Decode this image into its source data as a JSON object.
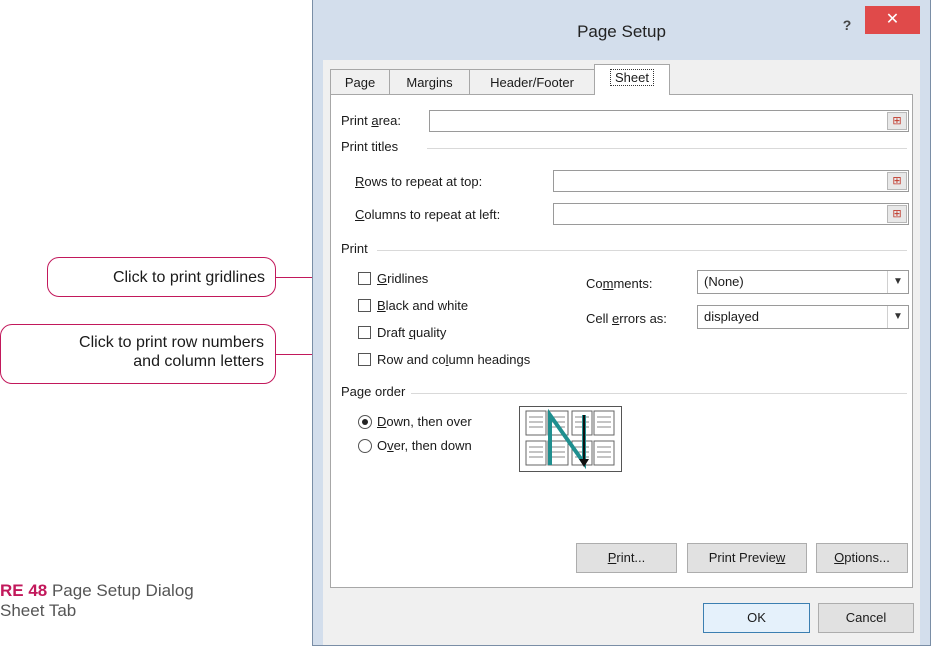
{
  "annotations": {
    "gridlines": "Click to print gridlines",
    "headings_line1": "Click to print row numbers",
    "headings_line2": "and column letters"
  },
  "caption": {
    "figure": "RE 48",
    "text": " Page Setup Dialog",
    "line2": " Sheet Tab"
  },
  "dialog": {
    "title": "Page Setup",
    "help": "?",
    "close": "✕",
    "tabs": [
      "Page",
      "Margins",
      "Header/Footer",
      "Sheet"
    ],
    "active_tab": "Sheet",
    "print_area": {
      "pre": "Print ",
      "key": "a",
      "post": "rea:",
      "value": ""
    },
    "print_titles": {
      "heading": "Print titles",
      "rows": {
        "key": "R",
        "post": "ows to repeat at top:",
        "value": ""
      },
      "columns": {
        "key": "C",
        "post": "olumns to repeat at left:",
        "value": ""
      }
    },
    "print": {
      "heading": "Print",
      "gridlines": {
        "key": "G",
        "post": "ridlines",
        "checked": false
      },
      "black_white": {
        "key": "B",
        "post": "lack and white",
        "checked": false
      },
      "draft": {
        "pre": "Draft ",
        "key": "q",
        "post": "uality",
        "checked": false
      },
      "headings": {
        "pre": "Row and co",
        "key": "l",
        "post": "umn headings",
        "checked": false
      },
      "comments": {
        "pre": "Co",
        "key": "m",
        "post": "ments:",
        "value": "(None)"
      },
      "cell_errors": {
        "pre": "Cell ",
        "key": "e",
        "post": "rrors as:",
        "value": "displayed"
      }
    },
    "page_order": {
      "heading": "Page order",
      "down_over": {
        "key": "D",
        "post": "own, then over",
        "selected": true
      },
      "over_down": {
        "pre": "O",
        "key": "v",
        "post": "er, then down",
        "selected": false
      }
    },
    "buttons": {
      "print": {
        "key": "P",
        "post": "rint..."
      },
      "preview": {
        "pre": "Print Previe",
        "key": "w",
        "post": ""
      },
      "options": {
        "key": "O",
        "post": "ptions..."
      },
      "ok": "OK",
      "cancel": "Cancel"
    },
    "colors": {
      "accent": "#c2185b",
      "close": "#e04a4a",
      "arrow": "#1f8f8f"
    }
  }
}
